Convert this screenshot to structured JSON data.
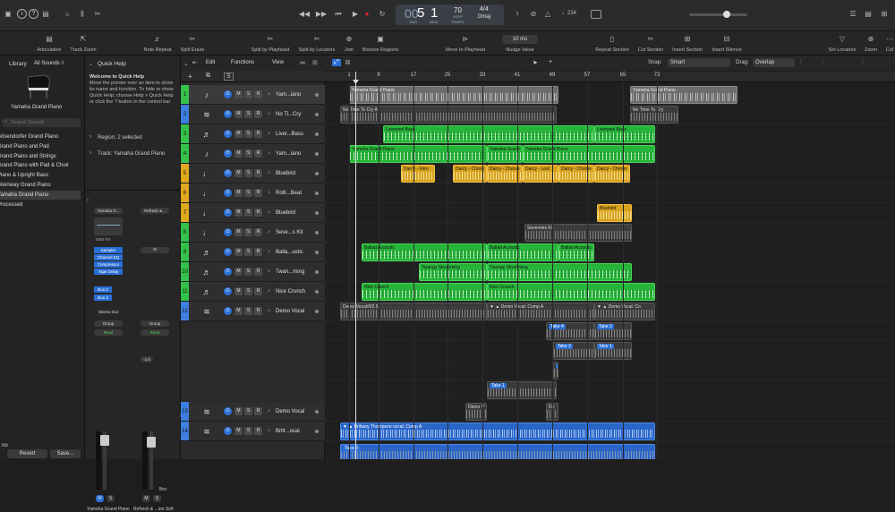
{
  "topbar": {
    "lcd": {
      "bar": "5",
      "beat": "1",
      "tempo": "70",
      "keep": "KEEP",
      "time_sig": "4/4",
      "key": "Dmaj",
      "bar_label": "BAR",
      "beat_label": "BEAT",
      "tempo_label": "TEMPO"
    },
    "cpu_readout": "♩234"
  },
  "toolbar2": {
    "items": [
      "Articulation",
      "Track Zoom",
      "Note Repeat",
      "Split Erase",
      "Split by Playhead",
      "Split by Locators",
      "Join",
      "Bounce Regions",
      "Move to Playhead",
      "Nudge Value",
      "Repeat Section",
      "Cut Section",
      "Insert Section",
      "Insert Silence",
      "Set Locators",
      "Zoom",
      "Col"
    ],
    "nudge_value": "10 ms"
  },
  "library": {
    "header": "Library",
    "filter": "All Sounds ◊",
    "patch": "Yamaha Grand Piano",
    "search_placeholder": "Search Sounds",
    "items": [
      "Bösendorfer Grand Piano",
      "Grand Piano and Pad",
      "Grand Piano and Strings",
      "Grand Piano with Pad & Choir",
      "Piano & Upright Bass",
      "Steinway Grand Piano",
      "Yamaha Grand Piano",
      "Processed"
    ],
    "footer": {
      "revert": "Revert",
      "save": "Save..."
    }
  },
  "quickhelp": {
    "title": "Quick Help",
    "heading": "Welcome to Quick Help",
    "body": "Move the pointer over an item to show its name and function. To hide or show Quick Help, choose Help > Quick Help or click the ? button in the control bar.",
    "region": "Region: 2 selected",
    "track": "Track: Yamaha Grand Piano",
    "strip1": {
      "setting": "Yamaha G...",
      "eq": "MIDI FX",
      "plugins": [
        "Sampler",
        "Channel EQ",
        "Compressor",
        "Tape Delay"
      ],
      "sends": [
        "Bus 2",
        "Bus 3"
      ],
      "output": "Stereo Out",
      "group": "Group",
      "auto": "Read",
      "pan": "2.7",
      "name": "Yamaha Grand Piano"
    },
    "strip2": {
      "setting": "Refresh &...",
      "group": "Group",
      "auto": "Read",
      "pan": "-2.5",
      "bnc": "Bnc",
      "name": "Refresh & ...ion Soft"
    }
  },
  "arrange_menu": {
    "edit": "Edit",
    "functions": "Functions",
    "view": "View",
    "snap_label": "Snap:",
    "snap": "Smart",
    "drag_label": "Drag:",
    "drag": "Overlap"
  },
  "ruler": [
    "1",
    "9",
    "17",
    "25",
    "33",
    "41",
    "49",
    "57",
    "65",
    "73"
  ],
  "tracks": [
    {
      "n": "1",
      "name": "Yam...iano",
      "icon": "♪",
      "color": "#34c24a",
      "sel": true
    },
    {
      "n": "2",
      "name": "No Ti...Cry",
      "icon": "≋",
      "color": "#3d7ee0"
    },
    {
      "n": "3",
      "name": "Liver...Bass",
      "icon": "♬",
      "color": "#34c24a"
    },
    {
      "n": "4",
      "name": "Yam...iano",
      "icon": "♪",
      "color": "#34c24a"
    },
    {
      "n": "5",
      "name": "Bluebird",
      "icon": "♩",
      "color": "#e0a81f"
    },
    {
      "n": "6",
      "name": "Rolli...Beat",
      "icon": "♩",
      "color": "#e0a81f"
    },
    {
      "n": "7",
      "name": "Bluebird",
      "icon": "♩",
      "color": "#e0a81f"
    },
    {
      "n": "8",
      "name": "Seve...s Kit",
      "icon": "♩",
      "color": "#34c24a"
    },
    {
      "n": "9",
      "name": "Balla...ustic",
      "icon": "♬",
      "color": "#34c24a"
    },
    {
      "n": "10",
      "name": "Twan...ming",
      "icon": "♬",
      "color": "#34c24a"
    },
    {
      "n": "11",
      "name": "Nice Crunch",
      "icon": "♬",
      "color": "#34c24a"
    },
    {
      "n": "12",
      "name": "Demo Vocal",
      "icon": "≋",
      "color": "#3d7ee0"
    },
    {
      "n": "13",
      "name": "Demo Vocal",
      "icon": "≋",
      "color": "#3d7ee0"
    },
    {
      "n": "14",
      "name": "Britt...ocal",
      "icon": "≋",
      "color": "#3d7ee0"
    }
  ],
  "regions": [
    {
      "lane": 0,
      "start": 27,
      "end": 261,
      "label": "Yamaha Grand Piano",
      "cls": "gr"
    },
    {
      "lane": 0,
      "start": 341,
      "end": 461,
      "label": "Yamaha Grand Piano",
      "cls": "gr"
    },
    {
      "lane": 1,
      "start": 17,
      "end": 259,
      "label": "No Time To Cry A",
      "cls": "dk"
    },
    {
      "lane": 1,
      "start": 341,
      "end": 395,
      "label": "No Time To Cry",
      "cls": "dk"
    },
    {
      "lane": 2,
      "start": 65,
      "end": 301,
      "label": "Liverpool Bass",
      "cls": "g"
    },
    {
      "lane": 2,
      "start": 301,
      "end": 369,
      "label": "Liverpool Bass",
      "cls": "g"
    },
    {
      "lane": 3,
      "start": 27,
      "end": 181,
      "label": "Yamaha Grand Piano",
      "cls": "g"
    },
    {
      "lane": 3,
      "start": 181,
      "end": 221,
      "label": "Yamaha Grand",
      "cls": "g"
    },
    {
      "lane": 3,
      "start": 221,
      "end": 369,
      "label": "Yamaha Grand Piano",
      "cls": "g"
    },
    {
      "lane": 4,
      "start": 85,
      "end": 123,
      "label": "Darcy - Intro",
      "cls": "y"
    },
    {
      "lane": 4,
      "start": 143,
      "end": 181,
      "label": "Darcy - Chorus",
      "cls": "y"
    },
    {
      "lane": 4,
      "start": 181,
      "end": 221,
      "label": "Darcy - Chorus",
      "cls": "y"
    },
    {
      "lane": 4,
      "start": 221,
      "end": 261,
      "label": "Darcy - Lost",
      "cls": "y"
    },
    {
      "lane": 4,
      "start": 261,
      "end": 301,
      "label": "Darcy - Chorus",
      "cls": "y"
    },
    {
      "lane": 4,
      "start": 301,
      "end": 341,
      "label": "Darcy - Chorus",
      "cls": "y"
    },
    {
      "lane": 6,
      "start": 304,
      "end": 343,
      "label": "Bluebird",
      "cls": "y"
    },
    {
      "lane": 7,
      "start": 223,
      "end": 343,
      "label": "Seventies Kit",
      "cls": "dk"
    },
    {
      "lane": 8,
      "start": 41,
      "end": 181,
      "label": "Ballad Acoustic",
      "cls": "g"
    },
    {
      "lane": 8,
      "start": 181,
      "end": 261,
      "label": "Ballad Acoustic",
      "cls": "g"
    },
    {
      "lane": 8,
      "start": 261,
      "end": 301,
      "label": "Ballad Acoustic",
      "cls": "g"
    },
    {
      "lane": 9,
      "start": 105,
      "end": 181,
      "label": "Twangy Strumming",
      "cls": "g"
    },
    {
      "lane": 9,
      "start": 181,
      "end": 343,
      "label": "Twangy Strumming",
      "cls": "g"
    },
    {
      "lane": 10,
      "start": 41,
      "end": 181,
      "label": "Nice Crunch",
      "cls": "g"
    },
    {
      "lane": 10,
      "start": 181,
      "end": 369,
      "label": "Nice Crunch",
      "cls": "g"
    },
    {
      "lane": 11,
      "start": 17,
      "end": 181,
      "label": "Demo Vocal#02.5",
      "cls": "dk"
    },
    {
      "lane": 11,
      "start": 181,
      "end": 301,
      "label": "▼ ▲ Demo Vocal: Comp A",
      "cls": "dk"
    },
    {
      "lane": 11,
      "start": 301,
      "end": 369,
      "label": "▼ ▲ Demo Vocal: Co",
      "cls": "dk"
    },
    {
      "lane": 16,
      "start": 157,
      "end": 181,
      "label": "Demo Vo",
      "cls": "dk"
    },
    {
      "lane": 16,
      "start": 247,
      "end": 261,
      "label": "De",
      "cls": "dk"
    },
    {
      "lane": 17,
      "start": 17,
      "end": 369,
      "label": "▼ ▲ Brittany Thompson vocal: Comp A",
      "cls": "bl"
    }
  ],
  "takes": [
    {
      "lane": 12,
      "start": 247,
      "end": 301,
      "label": "Take 4"
    },
    {
      "lane": 12,
      "start": 301,
      "end": 343,
      "label": "Take 2"
    },
    {
      "lane": 13,
      "start": 255,
      "end": 301,
      "label": "Take 3"
    },
    {
      "lane": 13,
      "start": 301,
      "end": 343,
      "label": "Take 1"
    },
    {
      "lane": 14,
      "start": 255,
      "end": 261,
      "label": "Ta"
    },
    {
      "lane": 15,
      "start": 181,
      "end": 259,
      "label": "Take 1"
    },
    {
      "lane": 18,
      "start": 17,
      "end": 369,
      "label": "Take 3"
    }
  ],
  "colors": {
    "accent": "#2b6fd6",
    "green": "#27b43a",
    "yellow": "#d8a21f",
    "record": "#e0262a"
  }
}
